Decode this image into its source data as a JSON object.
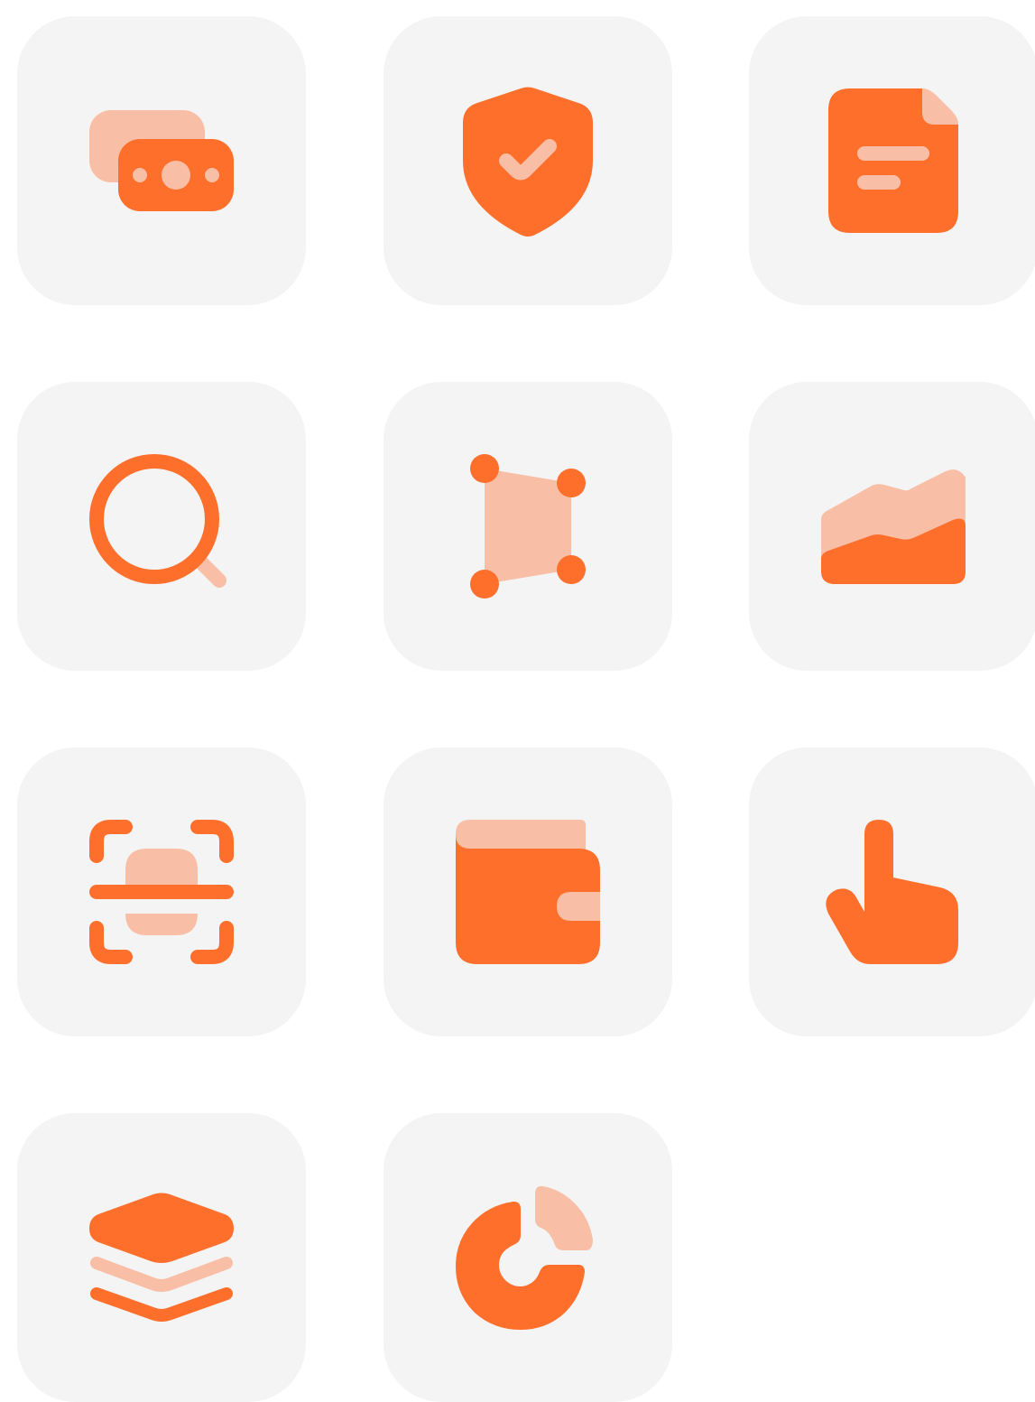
{
  "colors": {
    "tile_background": "#f4f4f4",
    "primary": "#ff6f2c",
    "secondary": "#f8bfa6",
    "page_background": "#ffffff"
  },
  "icons": [
    {
      "name": "money-icon"
    },
    {
      "name": "shield-check-icon"
    },
    {
      "name": "document-icon"
    },
    {
      "name": "search-icon"
    },
    {
      "name": "shape-nodes-icon"
    },
    {
      "name": "area-chart-icon"
    },
    {
      "name": "scan-icon"
    },
    {
      "name": "wallet-icon"
    },
    {
      "name": "pointer-hand-icon"
    },
    {
      "name": "layers-icon"
    },
    {
      "name": "donut-chart-icon"
    }
  ]
}
